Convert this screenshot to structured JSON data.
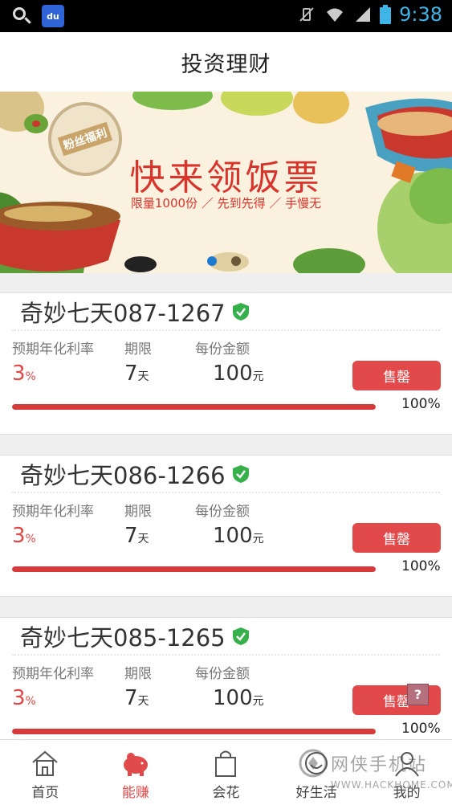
{
  "status_bar": {
    "time": "9:38",
    "baidu_badge": "du"
  },
  "header": {
    "title": "投资理财"
  },
  "banner": {
    "stamp_text": "粉丝福利",
    "headline": "快来领饭票",
    "subline": "限量1000份 ／ 先到先得 ／ 手慢无",
    "active_dot_color": "#1e7bd0"
  },
  "labels": {
    "rate": "预期年化利率",
    "term": "期限",
    "amount": "每份金额"
  },
  "products": [
    {
      "name": "奇妙七天087-1267",
      "rate_value": "3",
      "rate_unit": "%",
      "term_value": "7",
      "term_unit": "天",
      "amount_value": "100",
      "amount_unit": "元",
      "status": "售罄",
      "progress": 1.0,
      "progress_text": "100%"
    },
    {
      "name": "奇妙七天086-1266",
      "rate_value": "3",
      "rate_unit": "%",
      "term_value": "7",
      "term_unit": "天",
      "amount_value": "100",
      "amount_unit": "元",
      "status": "售罄",
      "progress": 1.0,
      "progress_text": "100%"
    },
    {
      "name": "奇妙七天085-1265",
      "rate_value": "3",
      "rate_unit": "%",
      "term_value": "7",
      "term_unit": "天",
      "amount_value": "100",
      "amount_unit": "元",
      "status": "售罄",
      "progress": 1.0,
      "progress_text": "100%"
    }
  ],
  "help": "?",
  "tabs": [
    {
      "label": "首页",
      "icon": "home-icon",
      "active": false
    },
    {
      "label": "能赚",
      "icon": "piggy-bank-icon",
      "active": true
    },
    {
      "label": "会花",
      "icon": "shopping-bag-icon",
      "active": false
    },
    {
      "label": "好生活",
      "icon": "life-icon",
      "active": false
    },
    {
      "label": "我的",
      "icon": "profile-icon",
      "active": false
    }
  ],
  "watermark": {
    "text": "网侠手机站",
    "sub": "WWW.HACKHOME.COM"
  },
  "colors": {
    "accent": "#e2494b",
    "tab_active": "#e04a4a",
    "verified": "#35b04a"
  }
}
